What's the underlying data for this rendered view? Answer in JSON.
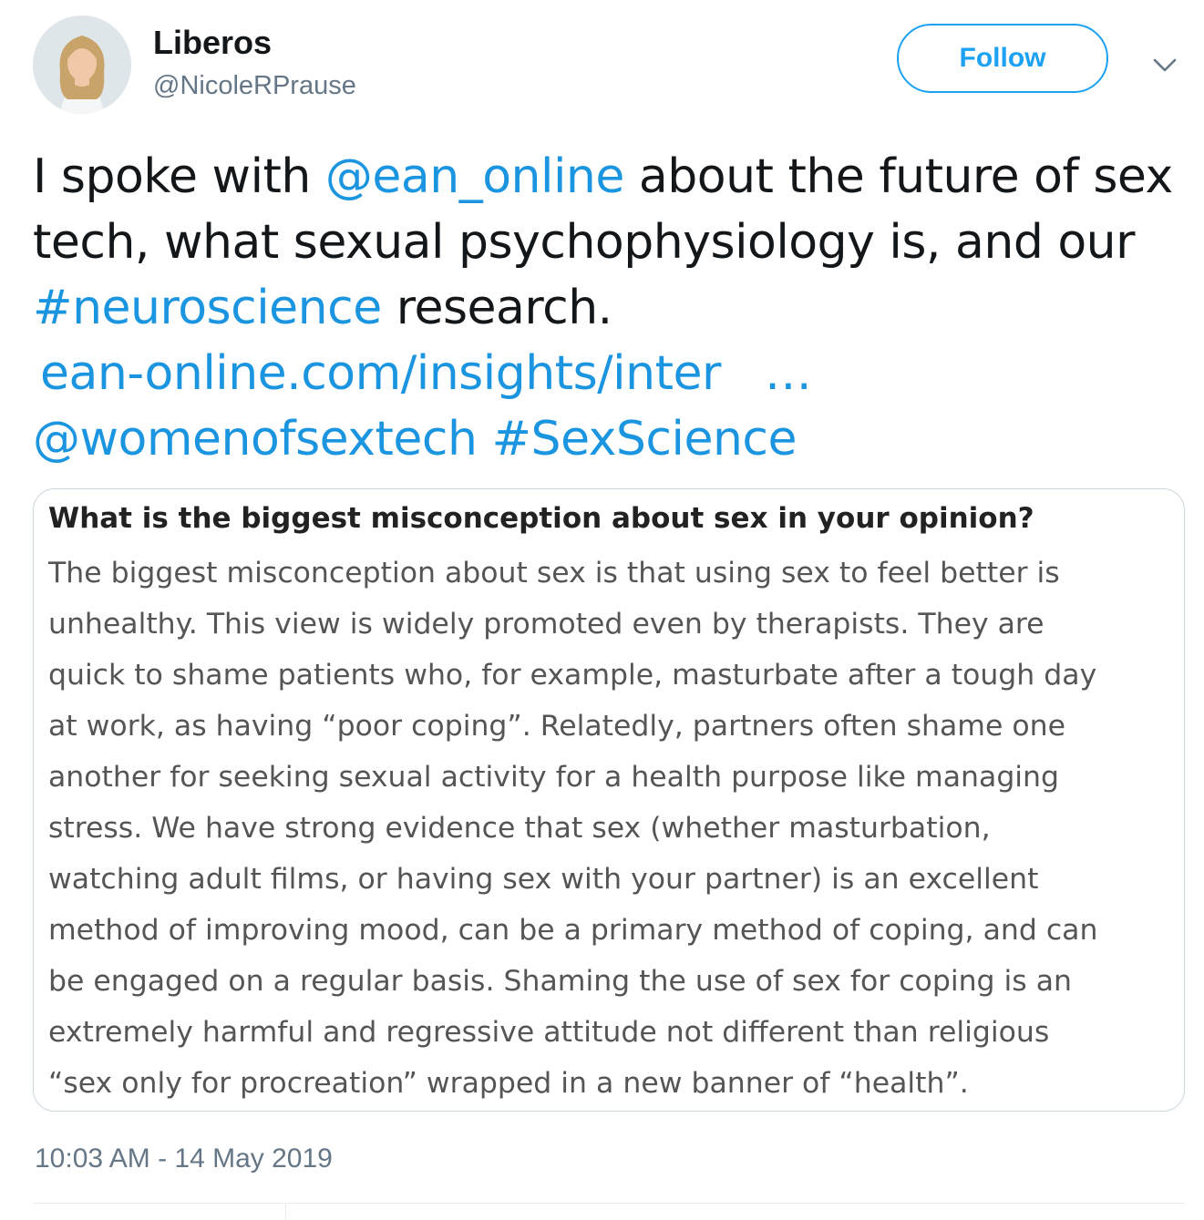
{
  "user": {
    "display_name": "Liberos",
    "handle": "@NicoleRPrause",
    "avatar_icon": "profile-photo"
  },
  "follow_label": "Follow",
  "menu_icon": "chevron-down-icon",
  "tweet": {
    "t1": "I spoke with ",
    "mention1": "@ean_online",
    "t2": " about the future of sex tech, what sexual psychophysiology is, and our ",
    "hashtag1": "#neuroscience",
    "t3": " research.",
    "url": "ean-online.com/insights/inter",
    "ellipsis": "…",
    "mention2": "@womenofsextech",
    "hashtag2": "#SexScience"
  },
  "card": {
    "question": "What is the biggest misconception about sex in your opinion?",
    "lines": [
      "The biggest misconception about sex is that using sex to feel better is",
      "unhealthy. This view is widely promoted even by therapists. They are",
      "quick to shame patients who, for example, masturbate after a tough day",
      "at work, as having “poor coping”. Relatedly, partners often shame one",
      "another for seeking sexual activity for a health purpose like managing",
      "stress. We have strong evidence that sex (whether masturbation,",
      "watching adult films, or having sex with your partner) is an excellent",
      "method of improving mood, can be a primary method of coping, and can",
      "be engaged on a regular basis. Shaming the use of sex for coping is an",
      "extremely harmful and regressive attitude not different than religious",
      "“sex only for procreation” wrapped in a new banner of “health”."
    ]
  },
  "timestamp": "10:03 AM - 14 May 2019",
  "colors": {
    "accent": "#1da1f2",
    "link": "#1b95e0",
    "text": "#14171a",
    "secondary": "#657786",
    "border": "#ccd6dd"
  }
}
